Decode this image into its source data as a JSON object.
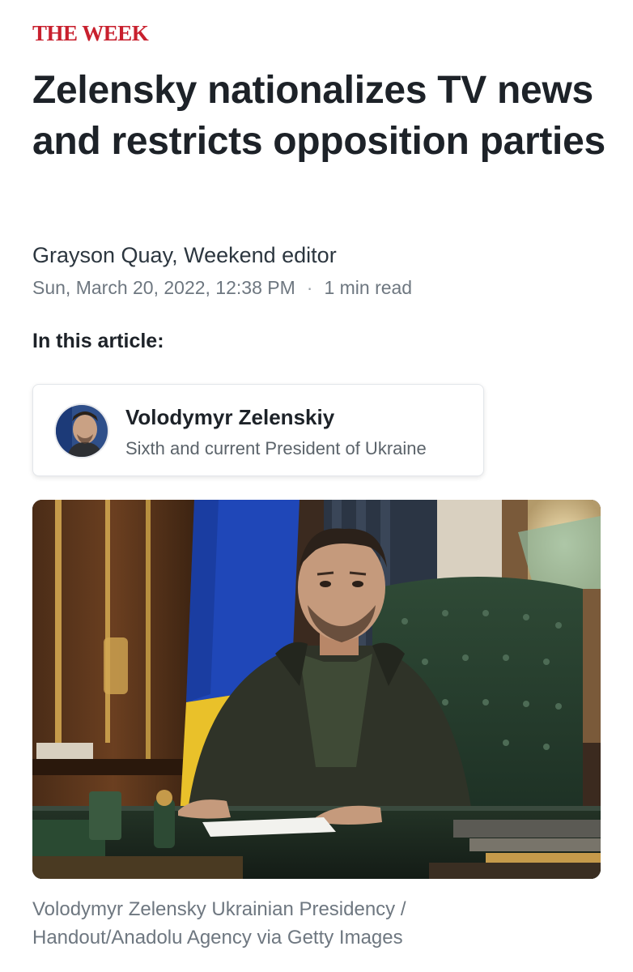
{
  "publisher": {
    "name": "THE WEEK"
  },
  "article": {
    "headline": "Zelensky nationalizes TV news and restricts opposition parties",
    "byline": "Grayson Quay, Weekend editor",
    "date": "Sun, March 20, 2022, 12:38 PM",
    "separator": "·",
    "read_time": "1 min read",
    "in_this_article_label": "In this article:"
  },
  "entity": {
    "name": "Volodymyr Zelenskiy",
    "description": "Sixth and current President of Ukraine",
    "avatar_icon": "person-portrait-icon"
  },
  "photo": {
    "caption": "Volodymyr Zelensky Ukrainian Presidency / Handout/Anadolu Agency via Getty Images"
  },
  "colors": {
    "brand": "#c8202e",
    "headline": "#1d2228",
    "muted": "#6e7780",
    "flag_blue": "#1f47b8",
    "flag_yellow": "#e9c12a"
  }
}
